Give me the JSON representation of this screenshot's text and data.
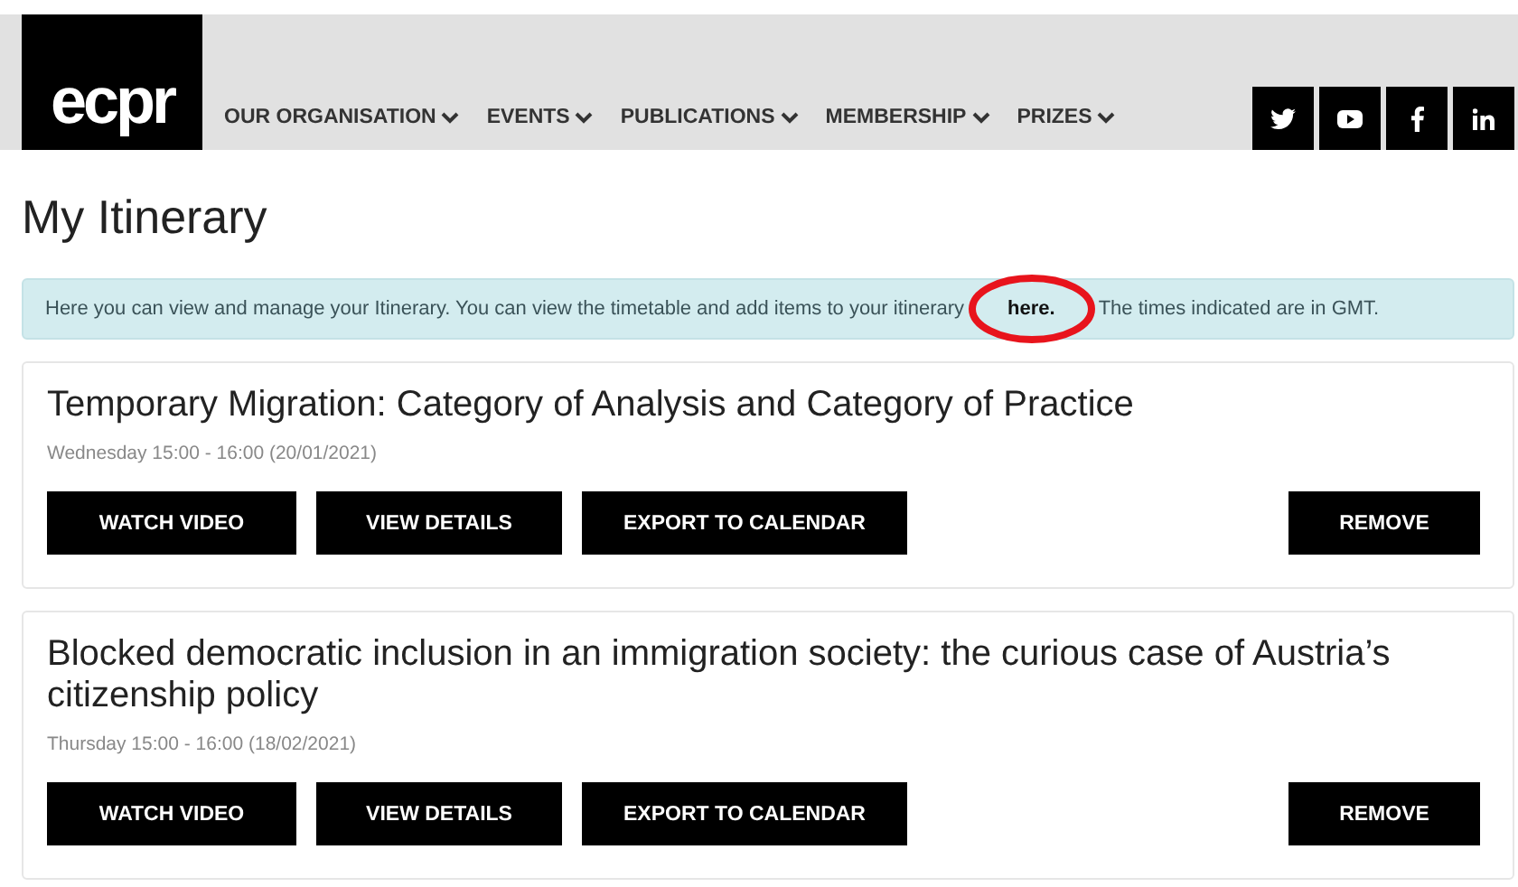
{
  "header": {
    "logo": "ecpr",
    "nav": [
      {
        "label": "OUR ORGANISATION"
      },
      {
        "label": "EVENTS"
      },
      {
        "label": "PUBLICATIONS"
      },
      {
        "label": "MEMBERSHIP"
      },
      {
        "label": "PRIZES"
      }
    ],
    "social": [
      {
        "kind": "twitter"
      },
      {
        "kind": "youtube"
      },
      {
        "kind": "facebook"
      },
      {
        "kind": "linkedin"
      }
    ]
  },
  "page_title": "My Itinerary",
  "notice": {
    "text_before": "Here you can view and manage your Itinerary. You can view the timetable and add items to your itinerary",
    "link": "here.",
    "text_after": "The times indicated are in GMT."
  },
  "items": [
    {
      "title": "Temporary Migration: Category of Analysis and Category of Practice",
      "time": "Wednesday 15:00 - 16:00 (20/01/2021)",
      "actions": [
        "WATCH VIDEO",
        "VIEW DETAILS",
        "EXPORT TO CALENDAR"
      ],
      "remove": "REMOVE"
    },
    {
      "title": "Blocked democratic inclusion in an immigration society: the curious case of Austria’s citizenship policy",
      "time": "Thursday 15:00 - 16:00 (18/02/2021)",
      "actions": [
        "WATCH VIDEO",
        "VIEW DETAILS",
        "EXPORT TO CALENDAR"
      ],
      "remove": "REMOVE"
    }
  ]
}
